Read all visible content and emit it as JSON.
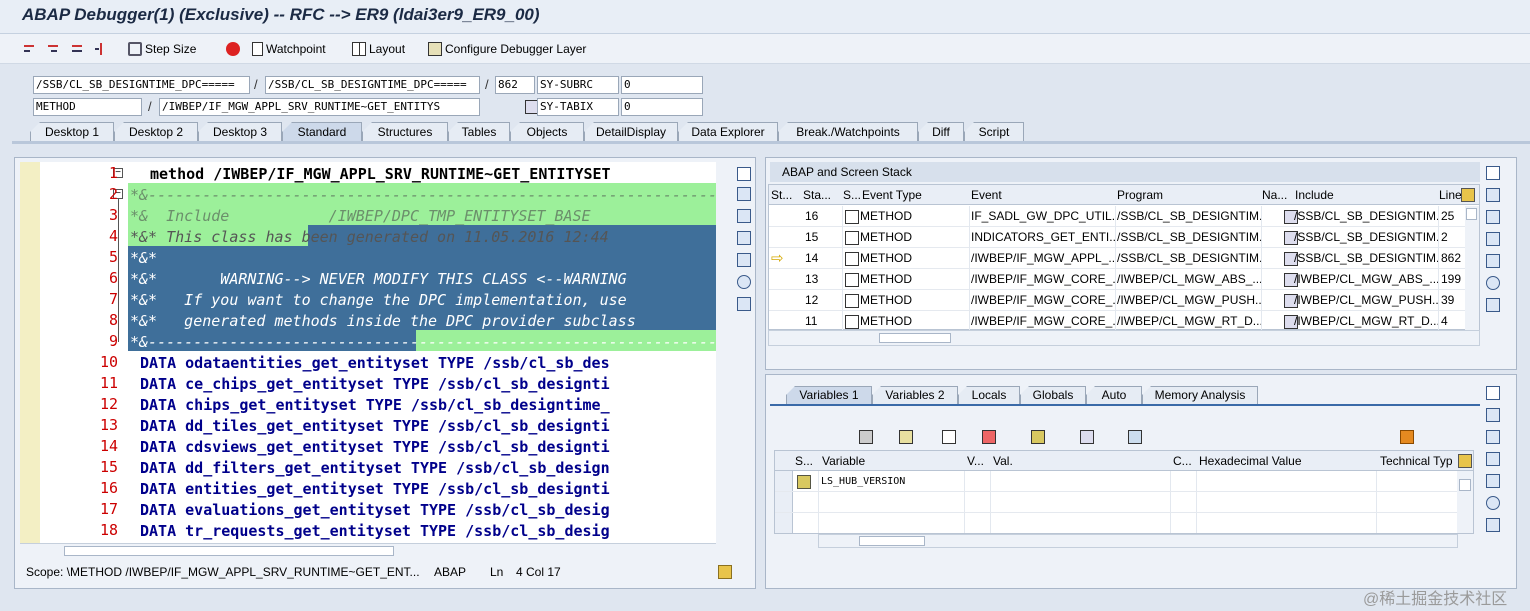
{
  "window": {
    "title": "ABAP Debugger(1)  (Exclusive) -- RFC --> ER9 (ldai3er9_ER9_00)"
  },
  "toolbar": {
    "step_size": "Step Size",
    "watchpoint": "Watchpoint",
    "layout": "Layout",
    "configure": "Configure Debugger Layer"
  },
  "context": {
    "program": "/SSB/CL_SB_DESIGNTIME_DPC=====",
    "include": "/SSB/CL_SB_DESIGNTIME_DPC=====",
    "line": "862",
    "event_type": "METHOD",
    "event": "/IWBEP/IF_MGW_APPL_SRV_RUNTIME~GET_ENTITYS",
    "sy1_name": "SY-SUBRC",
    "sy1_value": "0",
    "sy2_name": "SY-TABIX",
    "sy2_value": "0"
  },
  "tabs": [
    "Desktop 1",
    "Desktop 2",
    "Desktop 3",
    "Standard",
    "Structures",
    "Tables",
    "Objects",
    "DetailDisplay",
    "Data Explorer",
    "Break./Watchpoints",
    "Diff",
    "Script"
  ],
  "active_tab": "Standard",
  "code": {
    "line_numbers": [
      "1",
      "2",
      "3",
      "4",
      "5",
      "6",
      "7",
      "8",
      "9",
      "10",
      "11",
      "12",
      "13",
      "14",
      "15",
      "16",
      "17",
      "18"
    ],
    "lines": [
      "method /IWBEP/IF_MGW_APPL_SRV_RUNTIME~GET_ENTITYSET",
      "*&---------------------------------------------------------------",
      "*&  Include           /IWBEP/DPC_TMP_ENTITYSET_BASE",
      "*&* This class has been generated on 11.05.2016 12:44",
      "*&*",
      "*&*       WARNING--> NEVER MODIFY THIS CLASS <--WARNING",
      "*&*   If you want to change the DPC implementation, use",
      "*&*   generated methods inside the DPC provider subclass",
      "*&---------------------------------------------------------------",
      "DATA odataentities_get_entityset TYPE /ssb/cl_sb_des",
      "DATA ce_chips_get_entityset TYPE /ssb/cl_sb_designti",
      "DATA chips_get_entityset TYPE /ssb/cl_sb_designtime_",
      "DATA dd_tiles_get_entityset TYPE /ssb/cl_sb_designti",
      "DATA cdsviews_get_entityset TYPE /ssb/cl_sb_designti",
      "DATA dd_filters_get_entityset TYPE /ssb/cl_sb_design",
      "DATA entities_get_entityset TYPE /ssb/cl_sb_designti",
      "DATA evaluations_get_entityset TYPE /ssb/cl_sb_desig",
      "DATA tr_requests_get_entityset TYPE /ssb/cl_sb_desig"
    ]
  },
  "status_bar": {
    "scope": "Scope: \\METHOD /IWBEP/IF_MGW_APPL_SRV_RUNTIME~GET_ENT...",
    "lang": "ABAP",
    "ln": "Ln",
    "pos": "4 Col  17"
  },
  "stack": {
    "title": "ABAP and Screen Stack",
    "columns": [
      "St...",
      "Sta...",
      "S...",
      "Event Type",
      "Event",
      "Program",
      "Na...",
      "Include",
      "Line"
    ],
    "rows": [
      {
        "sta": "16",
        "etype": "METHOD",
        "event": "IF_SADL_GW_DPC_UTIL...",
        "program": "/SSB/CL_SB_DESIGNTIM...",
        "include": "/SSB/CL_SB_DESIGNTIM...",
        "line": "25"
      },
      {
        "sta": "15",
        "etype": "METHOD",
        "event": "INDICATORS_GET_ENTI...",
        "program": "/SSB/CL_SB_DESIGNTIM...",
        "include": "/SSB/CL_SB_DESIGNTIM...",
        "line": "2"
      },
      {
        "sta": "14",
        "etype": "METHOD",
        "event": "/IWBEP/IF_MGW_APPL_...",
        "program": "/SSB/CL_SB_DESIGNTIM...",
        "include": "/SSB/CL_SB_DESIGNTIM...",
        "line": "862"
      },
      {
        "sta": "13",
        "etype": "METHOD",
        "event": "/IWBEP/IF_MGW_CORE_...",
        "program": "/IWBEP/CL_MGW_ABS_...",
        "include": "/IWBEP/CL_MGW_ABS_...",
        "line": "199"
      },
      {
        "sta": "12",
        "etype": "METHOD",
        "event": "/IWBEP/IF_MGW_CORE_...",
        "program": "/IWBEP/CL_MGW_PUSH...",
        "include": "/IWBEP/CL_MGW_PUSH...",
        "line": "39"
      },
      {
        "sta": "11",
        "etype": "METHOD",
        "event": "/IWBEP/IF_MGW_CORE_...",
        "program": "/IWBEP/CL_MGW_RT_D...",
        "include": "/IWBEP/CL_MGW_RT_D...",
        "line": "4"
      }
    ]
  },
  "variables": {
    "tabs": [
      "Variables 1",
      "Variables 2",
      "Locals",
      "Globals",
      "Auto",
      "Memory Analysis"
    ],
    "columns": [
      "S...",
      "Variable",
      "V...",
      "Val.",
      "C...",
      "Hexadecimal Value",
      "Technical Typ"
    ],
    "row1_var": "LS_HUB_VERSION"
  },
  "watermark": "@稀土掘金技术社区"
}
